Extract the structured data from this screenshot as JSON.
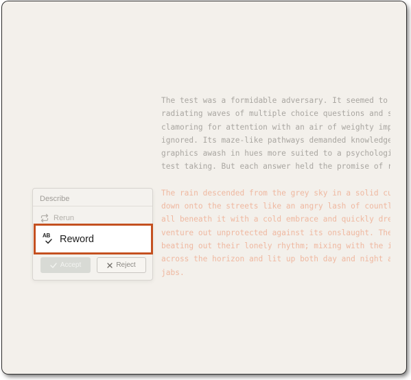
{
  "document": {
    "paragraph1": [
      "The test was a formidable adversary. It seemed to",
      "radiating waves of multiple choice questions and s",
      "clamoring for attention with an air of weighty imp",
      "ignored. Its maze-like pathways demanded knowledge",
      "graphics awash in hues more suited to a psychologi",
      "test taking. But each answer held the promise of r"
    ],
    "paragraph2": [
      "The rain descended from the grey sky in a solid cu",
      "down onto the streets like an angry lash of countl",
      "all beneath it with a cold embrace and quickly dre",
      "venture out unprotected against its onslaught. The",
      "beating out their lonely rhythm; mixing with the i",
      "across the horizon and lit up both day and night a",
      "jabs."
    ]
  },
  "menu": {
    "describe_label": "Describe",
    "rerun_label": "Rerun",
    "reword_label": "Reword",
    "accept_label": "Accept",
    "reject_label": "Reject"
  },
  "colors": {
    "highlight_border": "#c4501f",
    "paragraph2_text": "#efb8a0"
  }
}
